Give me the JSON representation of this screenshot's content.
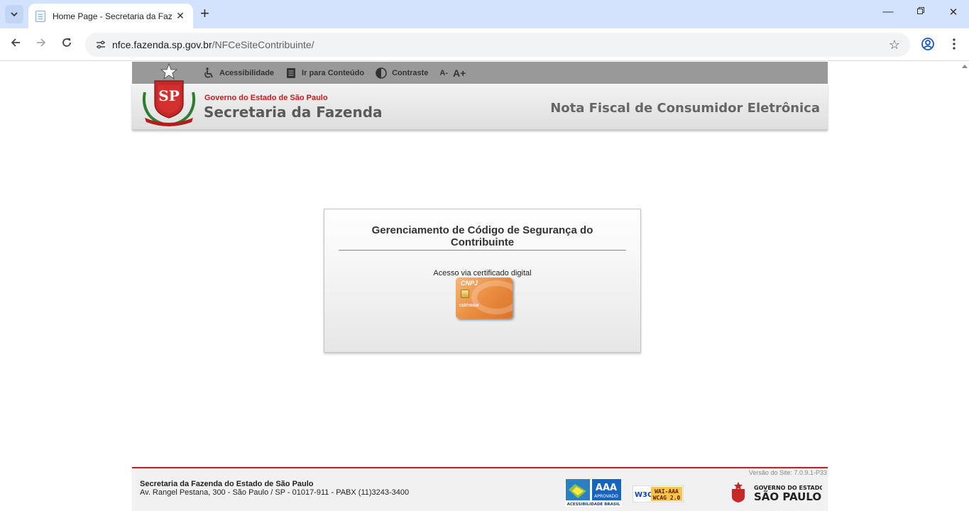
{
  "browser": {
    "tab_title": "Home Page - Secretaria da Fazenda",
    "url_host": "nfce.fazenda.sp.gov.br",
    "url_path": "/NFCeSiteContribuinte/"
  },
  "accessibility_bar": {
    "items": [
      {
        "label": "Acessibilidade",
        "icon": "wheelchair-icon"
      },
      {
        "label": "Ir para Conteúdo",
        "icon": "document-icon"
      },
      {
        "label": "Contraste",
        "icon": "contrast-icon"
      }
    ],
    "font_decrease": "A-",
    "font_increase": "A+"
  },
  "header": {
    "government": "Governo do Estado de São Paulo",
    "department": "Secretaria da Fazenda",
    "system_title": "Nota Fiscal de Consumidor Eletrônica",
    "seal_text": "SP"
  },
  "panel": {
    "title": "Gerenciamento de Código de Segurança do Contribuinte",
    "access_label": "Acesso via certificado digital",
    "card_label": "CNPJ",
    "card_brand": "CERTISIGN"
  },
  "footer": {
    "version": "Versão do Site: 7.0.9.1-P33",
    "org": "Secretaria da Fazenda do Estado de São Paulo",
    "address": "Av. Rangel Pestana, 300 - São Paulo / SP - 01017-911 - PABX (11)3243-3400",
    "aaa_text": "AAA",
    "aaa_sub": "APROVADO",
    "aaa_caption": "ACESSIBILIDADE BRASIL",
    "w3c_text": "WAI-AAA",
    "wcag_text": "WCAG 2.0",
    "gov_logo_line1": "GOVERNO DO ESTADO",
    "gov_logo_line2": "SÃO PAULO"
  },
  "colors": {
    "accent_red": "#c81d1d",
    "gov_red": "#cc1a1a",
    "acc_bar_gray": "#999999"
  }
}
